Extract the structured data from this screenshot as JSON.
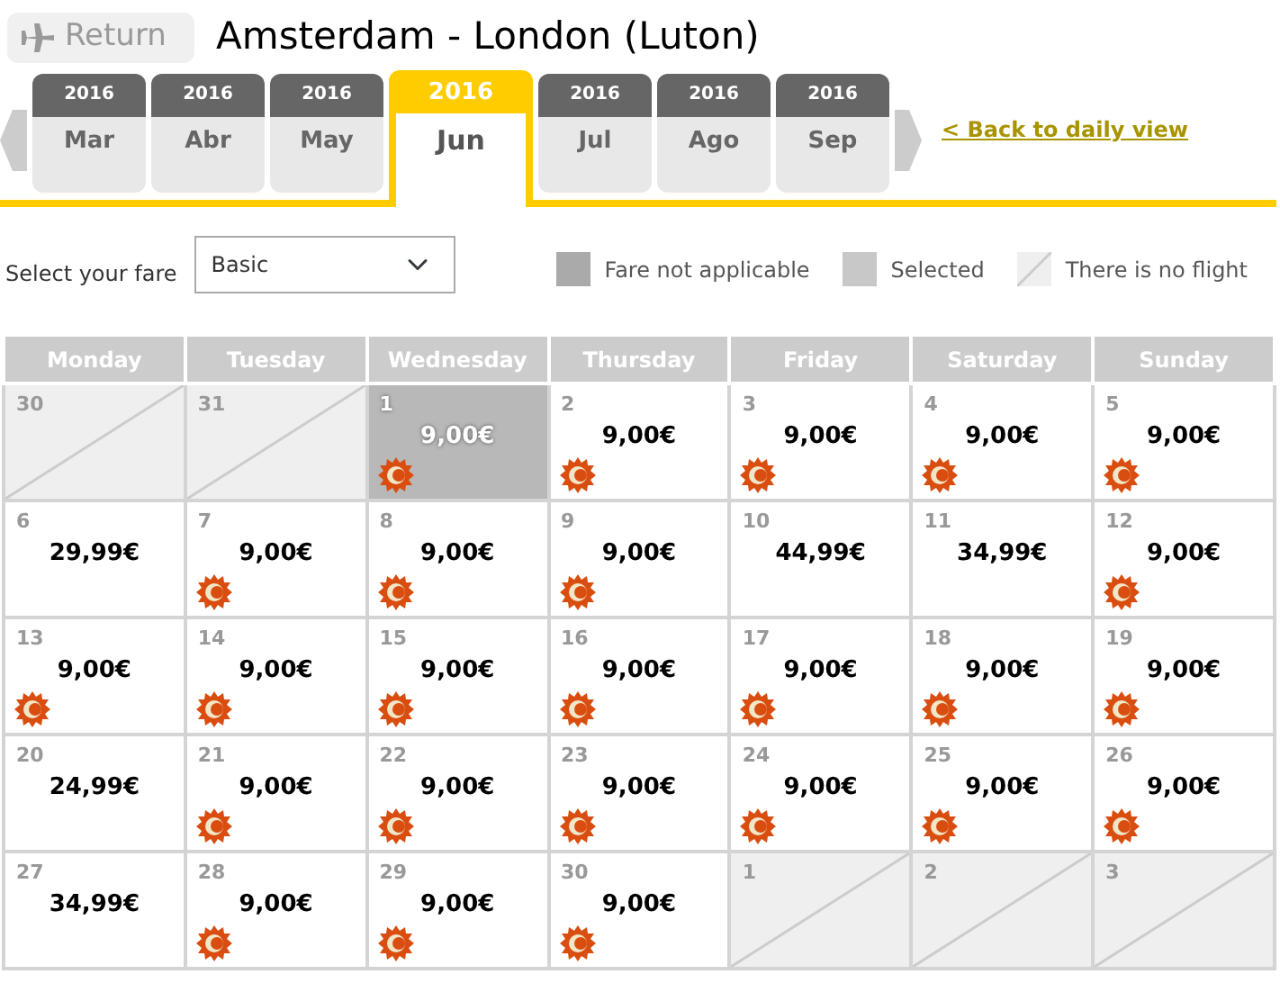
{
  "header": {
    "return_button": "Return",
    "title": "Amsterdam - London (Luton)"
  },
  "months": [
    {
      "year": "2016",
      "month": "Mar",
      "selected": false
    },
    {
      "year": "2016",
      "month": "Abr",
      "selected": false
    },
    {
      "year": "2016",
      "month": "May",
      "selected": false
    },
    {
      "year": "2016",
      "month": "Jun",
      "selected": true
    },
    {
      "year": "2016",
      "month": "Jul",
      "selected": false
    },
    {
      "year": "2016",
      "month": "Ago",
      "selected": false
    },
    {
      "year": "2016",
      "month": "Sep",
      "selected": false
    }
  ],
  "back_link": "< Back to daily view",
  "fare": {
    "label": "Select your fare",
    "value": "Basic"
  },
  "legend": [
    {
      "kind": "not_applicable",
      "label": "Fare not applicable"
    },
    {
      "kind": "selected",
      "label": "Selected"
    },
    {
      "kind": "no_flight",
      "label": "There is no flight"
    }
  ],
  "calendar": {
    "weekdays": [
      "Monday",
      "Tuesday",
      "Wednesday",
      "Thursday",
      "Friday",
      "Saturday",
      "Sunday"
    ],
    "weeks": [
      [
        {
          "day": "30",
          "kind": "no_flight"
        },
        {
          "day": "31",
          "kind": "no_flight"
        },
        {
          "day": "1",
          "kind": "fare",
          "price": "9,00€",
          "promo": true,
          "selected": true
        },
        {
          "day": "2",
          "kind": "fare",
          "price": "9,00€",
          "promo": true,
          "selected": false
        },
        {
          "day": "3",
          "kind": "fare",
          "price": "9,00€",
          "promo": true,
          "selected": false
        },
        {
          "day": "4",
          "kind": "fare",
          "price": "9,00€",
          "promo": true,
          "selected": false
        },
        {
          "day": "5",
          "kind": "fare",
          "price": "9,00€",
          "promo": true,
          "selected": false
        }
      ],
      [
        {
          "day": "6",
          "kind": "fare",
          "price": "29,99€",
          "promo": false,
          "selected": false
        },
        {
          "day": "7",
          "kind": "fare",
          "price": "9,00€",
          "promo": true,
          "selected": false
        },
        {
          "day": "8",
          "kind": "fare",
          "price": "9,00€",
          "promo": true,
          "selected": false
        },
        {
          "day": "9",
          "kind": "fare",
          "price": "9,00€",
          "promo": true,
          "selected": false
        },
        {
          "day": "10",
          "kind": "fare",
          "price": "44,99€",
          "promo": false,
          "selected": false
        },
        {
          "day": "11",
          "kind": "fare",
          "price": "34,99€",
          "promo": false,
          "selected": false
        },
        {
          "day": "12",
          "kind": "fare",
          "price": "9,00€",
          "promo": true,
          "selected": false
        }
      ],
      [
        {
          "day": "13",
          "kind": "fare",
          "price": "9,00€",
          "promo": true,
          "selected": false
        },
        {
          "day": "14",
          "kind": "fare",
          "price": "9,00€",
          "promo": true,
          "selected": false
        },
        {
          "day": "15",
          "kind": "fare",
          "price": "9,00€",
          "promo": true,
          "selected": false
        },
        {
          "day": "16",
          "kind": "fare",
          "price": "9,00€",
          "promo": true,
          "selected": false
        },
        {
          "day": "17",
          "kind": "fare",
          "price": "9,00€",
          "promo": true,
          "selected": false
        },
        {
          "day": "18",
          "kind": "fare",
          "price": "9,00€",
          "promo": true,
          "selected": false
        },
        {
          "day": "19",
          "kind": "fare",
          "price": "9,00€",
          "promo": true,
          "selected": false
        }
      ],
      [
        {
          "day": "20",
          "kind": "fare",
          "price": "24,99€",
          "promo": false,
          "selected": false
        },
        {
          "day": "21",
          "kind": "fare",
          "price": "9,00€",
          "promo": true,
          "selected": false
        },
        {
          "day": "22",
          "kind": "fare",
          "price": "9,00€",
          "promo": true,
          "selected": false
        },
        {
          "day": "23",
          "kind": "fare",
          "price": "9,00€",
          "promo": true,
          "selected": false
        },
        {
          "day": "24",
          "kind": "fare",
          "price": "9,00€",
          "promo": true,
          "selected": false
        },
        {
          "day": "25",
          "kind": "fare",
          "price": "9,00€",
          "promo": true,
          "selected": false
        },
        {
          "day": "26",
          "kind": "fare",
          "price": "9,00€",
          "promo": true,
          "selected": false
        }
      ],
      [
        {
          "day": "27",
          "kind": "fare",
          "price": "34,99€",
          "promo": false,
          "selected": false
        },
        {
          "day": "28",
          "kind": "fare",
          "price": "9,00€",
          "promo": true,
          "selected": false
        },
        {
          "day": "29",
          "kind": "fare",
          "price": "9,00€",
          "promo": true,
          "selected": false
        },
        {
          "day": "30",
          "kind": "fare",
          "price": "9,00€",
          "promo": true,
          "selected": false
        },
        {
          "day": "1",
          "kind": "no_flight"
        },
        {
          "day": "2",
          "kind": "no_flight"
        },
        {
          "day": "3",
          "kind": "no_flight"
        }
      ]
    ]
  }
}
